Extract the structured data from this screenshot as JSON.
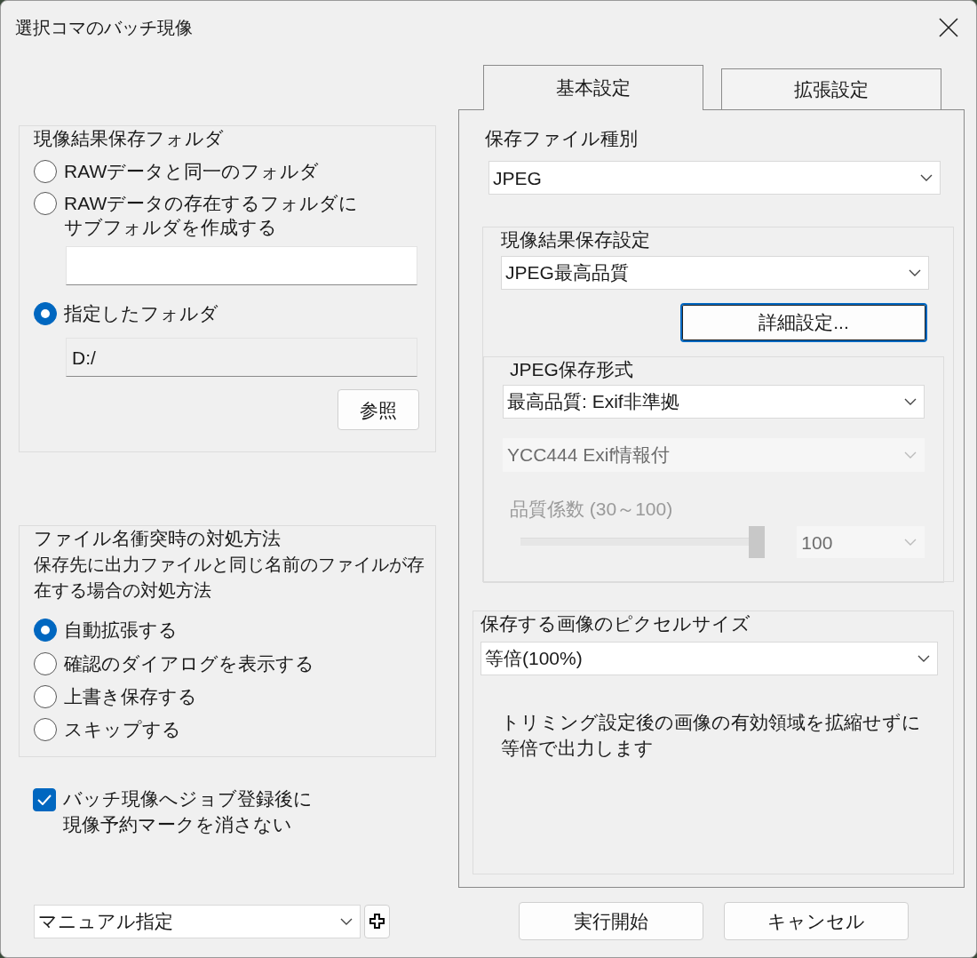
{
  "window": {
    "title": "選択コマのバッチ現像"
  },
  "output_folder": {
    "title": "現像結果保存フォルダ",
    "options": [
      {
        "label": "RAWデータと同一のフォルダ",
        "kind": "plain",
        "selected": false
      },
      {
        "label": "RAWデータの存在するフォルダにサブフォルダを作成する",
        "kind": "subfolder",
        "selected": false
      },
      {
        "label": "指定したフォルダ",
        "kind": "specified",
        "selected": true
      }
    ],
    "folder_path": "D:/",
    "browse_button": "参照"
  },
  "conflict": {
    "title": "ファイル名衝突時の対処方法",
    "description": "保存先に出力ファイルと同じ名前のファイルが存在する場合の対処方法",
    "options": [
      {
        "label": "自動拡張する",
        "selected": true
      },
      {
        "label": "確認のダイアログを表示する",
        "selected": false
      },
      {
        "label": "上書き保存する",
        "selected": false
      },
      {
        "label": "スキップする",
        "selected": false
      }
    ]
  },
  "keep_mark": {
    "label": "バッチ現像へジョブ登録後に現像予約マークを消さない",
    "checked": true
  },
  "preset": {
    "value": "マニュアル指定"
  },
  "tabs": [
    {
      "label": "基本設定",
      "selected": true
    },
    {
      "label": "拡張設定",
      "selected": false
    }
  ],
  "file_type": {
    "label": "保存ファイル種別",
    "value": "JPEG"
  },
  "save_settings": {
    "title": "現像結果保存設定",
    "value": "JPEG最高品質",
    "detail_button": "詳細設定...",
    "jpeg_format": {
      "title": "JPEG保存形式",
      "value": "最高品質: Exif非準拠",
      "subsampling": {
        "value": "YCC444 Exif情報付",
        "disabled": true
      },
      "quality": {
        "label": "品質係数 (30～100)",
        "level": 1.0,
        "value": "100",
        "disabled": true
      }
    }
  },
  "pixel_size": {
    "title": "保存する画像のピクセルサイズ",
    "value": "等倍(100%)",
    "note": "トリミング設定後の画像の有効領域を拡縮せずに等倍で出力します"
  },
  "buttons": [
    {
      "label": "実行開始"
    },
    {
      "label": "キャンセル"
    }
  ]
}
